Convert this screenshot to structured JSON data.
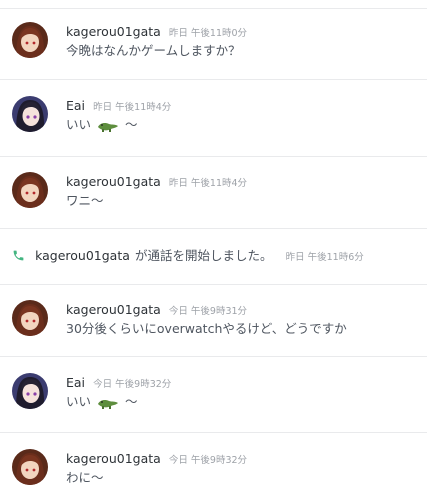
{
  "messages": [
    {
      "author": "kagerou01gata",
      "time": "昨日 午後11時0分",
      "text": "今晩はなんかゲームしますか？",
      "avatar": "kagerou"
    },
    {
      "author": "Eai",
      "time": "昨日 午後11時4分",
      "text_before": "いい",
      "emoji": "crocodile-emoji",
      "text_after": "〜",
      "avatar": "eai"
    },
    {
      "author": "kagerou01gata",
      "time": "昨日 午後11時4分",
      "text": "ワニ〜",
      "avatar": "kagerou"
    },
    {
      "author": "kagerou01gata",
      "time": "今日 午後9時31分",
      "text": "30分後くらいにoverwatchやるけど、どうですか",
      "avatar": "kagerou"
    },
    {
      "author": "Eai",
      "time": "今日 午後9時32分",
      "text_before": "いい",
      "emoji": "crocodile-emoji",
      "text_after": "〜",
      "avatar": "eai"
    },
    {
      "author": "kagerou01gata",
      "time": "今日 午後9時32分",
      "text": "わに〜",
      "avatar": "kagerou"
    }
  ],
  "call": {
    "icon": "phone-icon",
    "caller": "kagerou01gata",
    "text": "が通話を開始しました。",
    "time": "昨日 午後11時6分"
  },
  "colors": {
    "call_icon": "#43b581",
    "emoji": "#5e8e3e",
    "divider": "#e9eaec",
    "timestamp": "#9ea2a8"
  }
}
